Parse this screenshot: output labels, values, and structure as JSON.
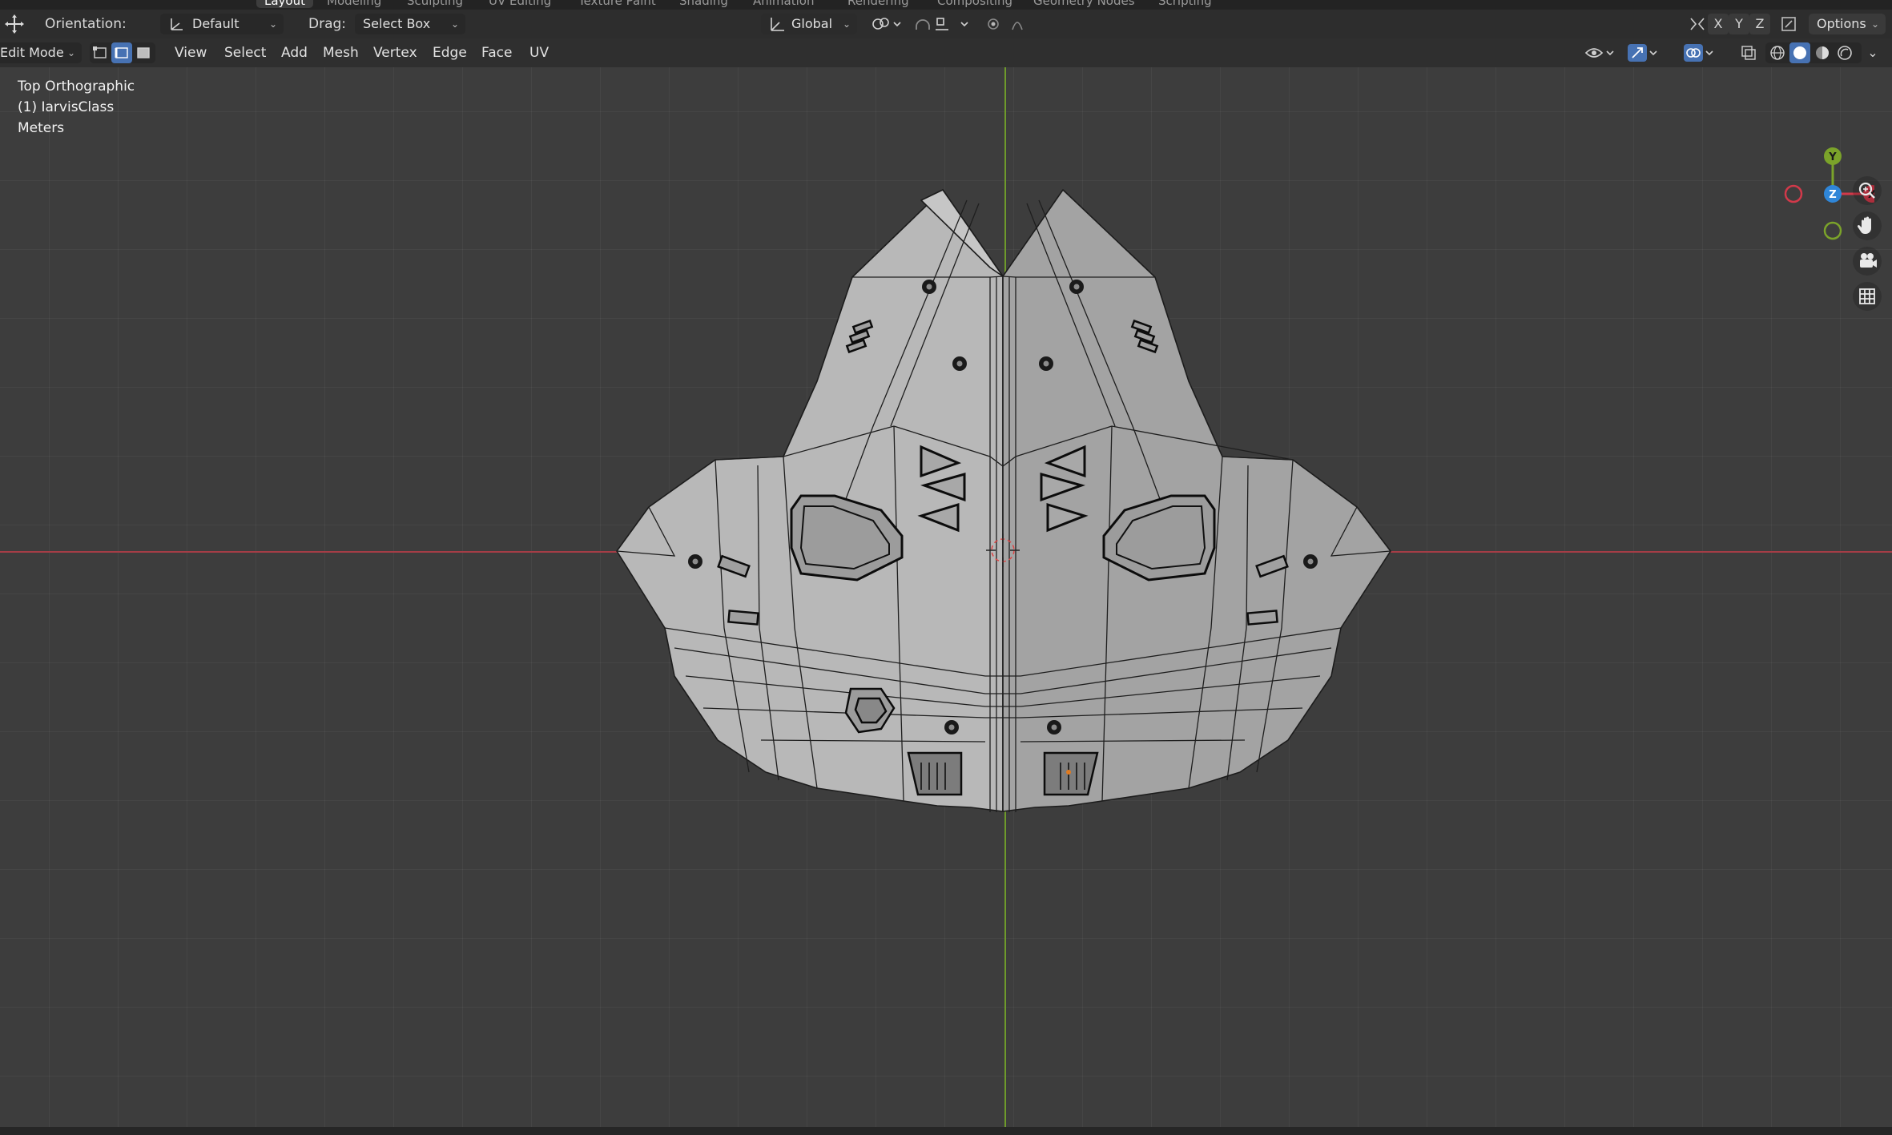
{
  "workspace_tabs": [
    {
      "label": "Layout",
      "active": true
    },
    {
      "label": "Modeling"
    },
    {
      "label": "Sculpting"
    },
    {
      "label": "UV Editing"
    },
    {
      "label": "Texture Paint"
    },
    {
      "label": "Shading"
    },
    {
      "label": "Animation"
    },
    {
      "label": "Rendering"
    },
    {
      "label": "Compositing"
    },
    {
      "label": "Geometry Nodes"
    },
    {
      "label": "Scripting"
    }
  ],
  "tool_header": {
    "orientation_label": "Orientation:",
    "orientation_value": "Default",
    "drag_label": "Drag:",
    "drag_value": "Select Box",
    "transform_orientation": "Global",
    "axis_x": "X",
    "axis_y": "Y",
    "axis_z": "Z",
    "options_label": "Options"
  },
  "header": {
    "mode": "Edit Mode",
    "menus": [
      "View",
      "Select",
      "Add",
      "Mesh",
      "Vertex",
      "Edge",
      "Face",
      "UV"
    ]
  },
  "viewport": {
    "view_name": "Top Orthographic",
    "object_name": "(1) IarvisClass",
    "units": "Meters"
  },
  "gizmo": {
    "y": "Y",
    "z": "Z",
    "x": "X"
  },
  "colors": {
    "axis_x": "#a53d46",
    "axis_y": "#6e9a2b",
    "gizmo_x": "#d2394a",
    "gizmo_y": "#7ba32a",
    "gizmo_z": "#2f86d8"
  },
  "icons": [
    "move-icon",
    "zoom-icon",
    "hand-pan-icon",
    "camera-icon",
    "grid-icon",
    "eye-icon",
    "gizmo-icon",
    "overlay-icon",
    "xray-icon",
    "shading-wire-icon",
    "shading-solid-icon",
    "shading-material-icon",
    "shading-rendered-icon"
  ]
}
